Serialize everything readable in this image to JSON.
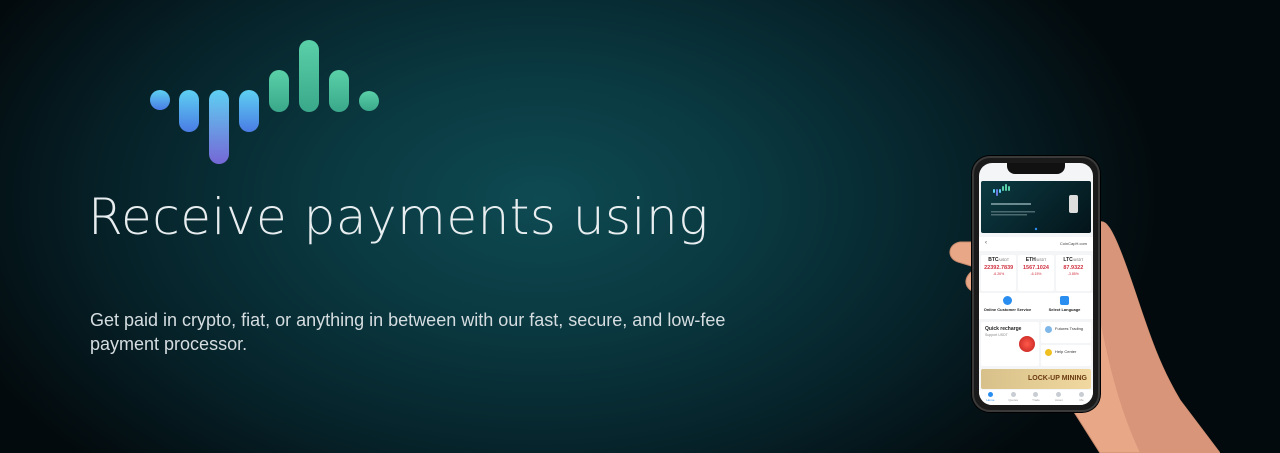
{
  "hero": {
    "headline": "Receive payments using",
    "subtext": "Get paid in crypto, fiat, or anything in between with our fast, secure, and low-fee payment processor."
  },
  "logo": {
    "icon": "sound-wave-logo",
    "colors": [
      "#5cb8f0",
      "#3a7fe0",
      "#7a6fd8",
      "#46c49a"
    ]
  },
  "phone": {
    "nav": {
      "back": "‹",
      "site": "CoinCapH.com"
    },
    "tickers": [
      {
        "symbol": "BTC",
        "quote": "/USDT",
        "price": "22392.7839",
        "change": "-6.26%"
      },
      {
        "symbol": "ETH",
        "quote": "/USDT",
        "price": "1567.1024",
        "change": "-6.15%"
      },
      {
        "symbol": "LTC",
        "quote": "/USDT",
        "price": "87.9322",
        "change": "-3.85%"
      }
    ],
    "services": {
      "customer_service": "Online Customer Service",
      "language": "Select Language"
    },
    "quick": {
      "title": "Quick recharge",
      "support": "Support USDT"
    },
    "side": {
      "futures": "Futures Trading",
      "help": "Help Center"
    },
    "promo": "LOCK-UP MINING",
    "tabs": [
      "Home",
      "Quotes",
      "Trade",
      "Asset",
      "Me"
    ]
  }
}
